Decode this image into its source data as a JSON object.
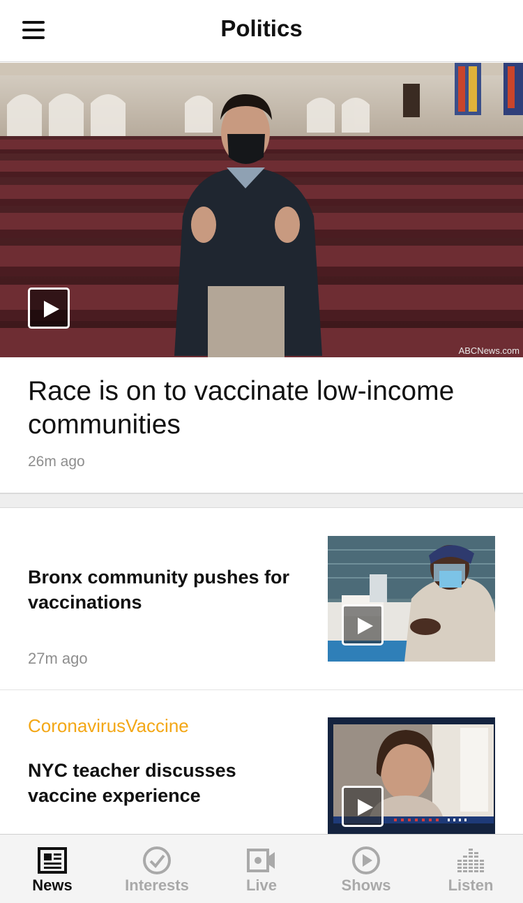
{
  "header": {
    "title": "Politics",
    "menu_icon": "hamburger-menu-icon"
  },
  "hero": {
    "headline": "Race is on to vaccinate low-income communities",
    "time": "26m ago",
    "credit": "ABCNews.com",
    "play_icon": "play-icon"
  },
  "stories": [
    {
      "tag": "",
      "title": "Bronx community pushes for vaccinations",
      "time": "27m ago"
    },
    {
      "tag": "CoronavirusVaccine",
      "title": "NYC teacher discusses vaccine experience",
      "time": ""
    }
  ],
  "tabbar": {
    "active": "News",
    "tabs": [
      {
        "label": "News",
        "icon": "newspaper-icon"
      },
      {
        "label": "Interests",
        "icon": "checkmark-circle-icon"
      },
      {
        "label": "Live",
        "icon": "video-camera-icon"
      },
      {
        "label": "Shows",
        "icon": "play-circle-icon"
      },
      {
        "label": "Listen",
        "icon": "equalizer-icon"
      }
    ]
  },
  "colors": {
    "tag": "#f3a716",
    "active_tab": "#111111",
    "inactive_tab": "#a9a9a9",
    "timestamp": "#8e8e8e"
  }
}
